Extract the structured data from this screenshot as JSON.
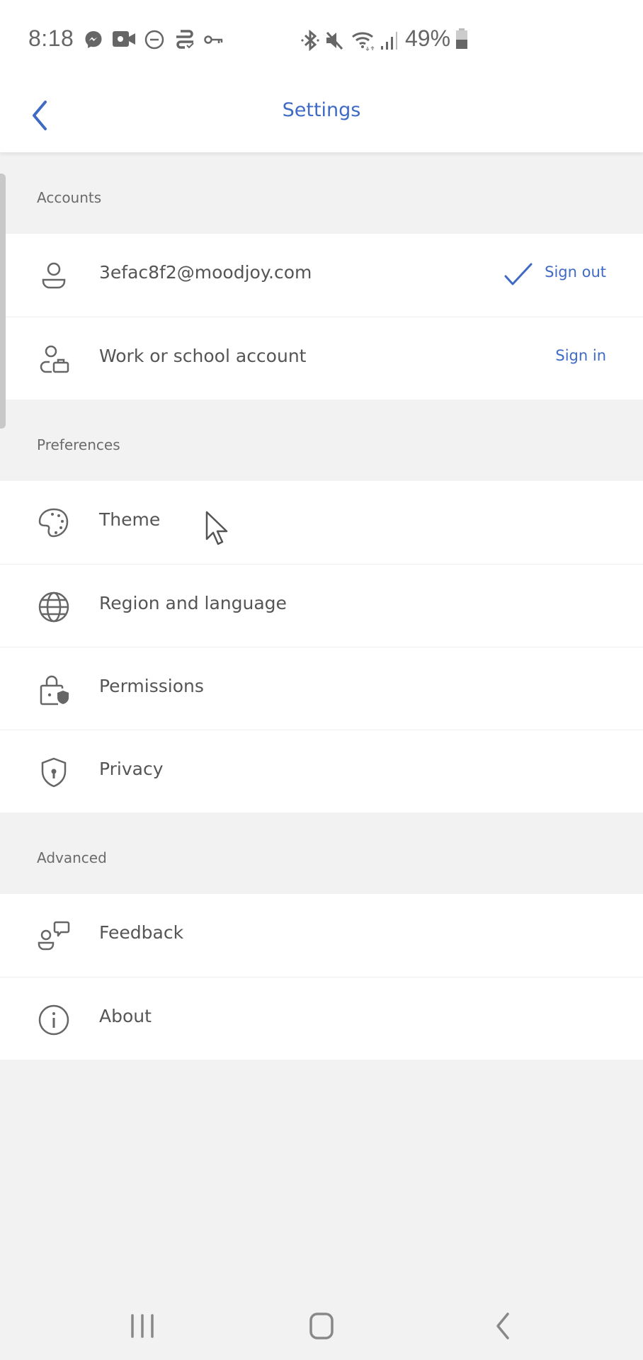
{
  "status_bar": {
    "time": "8:18",
    "left_icons": [
      "messenger-icon",
      "video-call-icon",
      "do-not-disturb-icon",
      "sync-icon",
      "vpn-key-icon"
    ],
    "right_icons": [
      "bluetooth-icon",
      "mute-icon",
      "wifi-icon",
      "signal-icon"
    ],
    "battery_percent": "49%",
    "battery_level": 0.49
  },
  "header": {
    "back_icon": "chevron-left-icon",
    "title": "Settings"
  },
  "colors": {
    "accent": "#3f6bc4",
    "text": "#555555",
    "section_bg": "#f2f2f2",
    "row_bg": "#ffffff"
  },
  "sections": [
    {
      "title": "Accounts",
      "items": [
        {
          "label": "3efac8f2@moodjoy.com",
          "icon": "person-icon",
          "action": "Sign out",
          "checked": true
        },
        {
          "label": "Work or school account",
          "icon": "work-account-icon",
          "action": "Sign in",
          "checked": false
        }
      ]
    },
    {
      "title": "Preferences",
      "items": [
        {
          "label": "Theme",
          "icon": "palette-icon"
        },
        {
          "label": "Region and language",
          "icon": "globe-icon"
        },
        {
          "label": "Permissions",
          "icon": "lock-shield-icon"
        },
        {
          "label": "Privacy",
          "icon": "shield-keyhole-icon"
        }
      ]
    },
    {
      "title": "Advanced",
      "items": [
        {
          "label": "Feedback",
          "icon": "feedback-icon"
        },
        {
          "label": "About",
          "icon": "info-icon"
        }
      ]
    }
  ],
  "nav_bar": {
    "recents": "recents-icon",
    "home": "home-icon",
    "back": "back-icon"
  }
}
